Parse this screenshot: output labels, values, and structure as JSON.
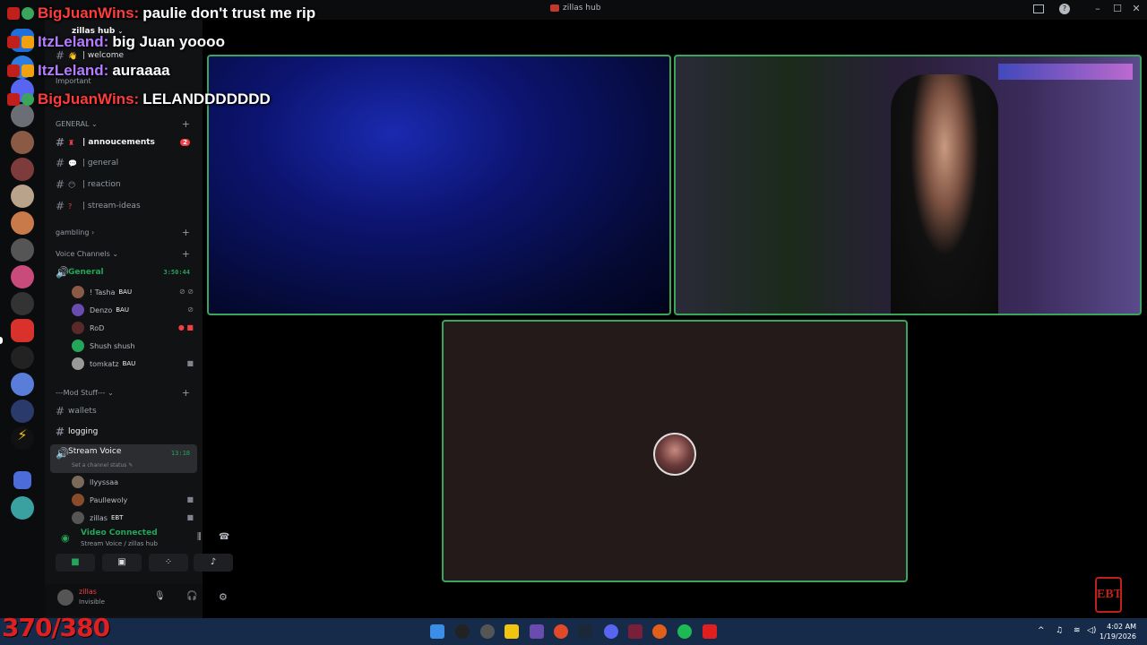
{
  "window": {
    "title": "zillas hub",
    "minimize": "–",
    "maximize": "☐",
    "close": "✕"
  },
  "chat": [
    {
      "user": "BigJuanWins",
      "color": "#ff3b3b",
      "message": "paulie don't trust me rip"
    },
    {
      "user": "ItzLeland",
      "color": "#b57cff",
      "message": "big Juan yoooo"
    },
    {
      "user": "ItzLeland",
      "color": "#b57cff",
      "message": "auraaaa"
    },
    {
      "user": "BigJuanWins",
      "color": "#ff3b3b",
      "message": "LELANDDDDDDD"
    }
  ],
  "server": {
    "name": "zillas hub"
  },
  "channels": {
    "welcome": "| welcome",
    "important_cat": "Important",
    "general_cat": "GENERAL",
    "annoucements": "| annoucements",
    "annoucements_badge": "2",
    "general": "| general",
    "reaction": "| reaction",
    "stream_ideas": "| stream-ideas",
    "gambling_cat": "gambling",
    "voice_cat": "Voice Channels",
    "voice_general": "General",
    "voice_general_time": "3:50:44",
    "mod_cat": "---Mod Stuff---",
    "wallets": "wallets",
    "logging": "logging",
    "stream_voice": "Stream Voice",
    "stream_voice_time": "13:18",
    "stream_voice_status": "Set a channel status"
  },
  "voice_general_users": [
    {
      "name": "! Tasha",
      "tag": "BAU"
    },
    {
      "name": "Denzo",
      "tag": "BAU"
    },
    {
      "name": "RoD",
      "tag": ""
    },
    {
      "name": "Shush shush",
      "tag": ""
    },
    {
      "name": "tomkatz",
      "tag": "BAU"
    }
  ],
  "stream_voice_users": [
    {
      "name": "llyyssaa",
      "tag": ""
    },
    {
      "name": "Paullewoly",
      "tag": ""
    },
    {
      "name": "zillas",
      "tag": "EBT"
    }
  ],
  "voice_panel": {
    "status": "Video Connected",
    "location": "Stream Voice / zillas hub"
  },
  "user_panel": {
    "name": "zillas",
    "status": "Invisible"
  },
  "counter": "370/380",
  "logo_text": "EBT",
  "taskbar": {
    "time": "4:02 AM",
    "date": "1/19/2026"
  },
  "colors": {
    "accent_green": "#3ba55c",
    "counter_red": "#e02020",
    "taskbar": "#162b4a"
  }
}
